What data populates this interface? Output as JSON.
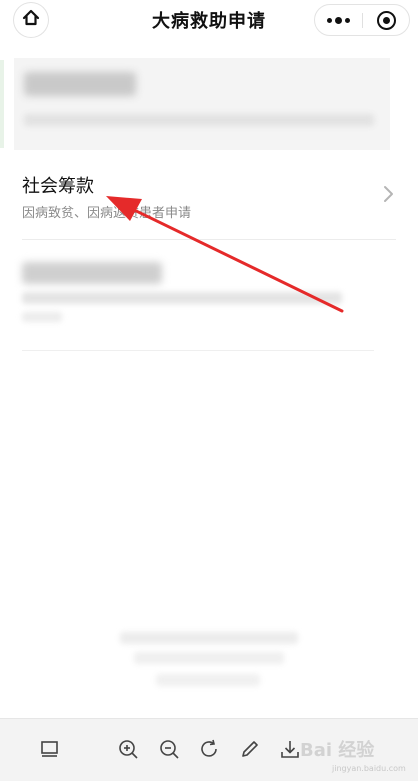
{
  "header": {
    "title": "大病救助申请",
    "home_icon": "home-icon",
    "more_icon": "more-dots-icon",
    "close_icon": "mini-program-close-icon"
  },
  "list": {
    "social_fundraising": {
      "title": "社会筹款",
      "subtitle": "因病致贫、因病返贫患者申请",
      "chevron_icon": "chevron-right-icon"
    }
  },
  "toolbar": {
    "icons": [
      "layout-icon",
      "zoom-in-icon",
      "zoom-out-icon",
      "rotate-icon",
      "edit-pencil-icon",
      "download-icon"
    ]
  },
  "watermark": {
    "text": "Bai 经验",
    "url": "jingyan.baidu.com"
  },
  "colors": {
    "annotation_arrow": "#e52a2a",
    "subtitle_gray": "#8a8a8a",
    "toolbar_bg": "#f3f3f3"
  }
}
